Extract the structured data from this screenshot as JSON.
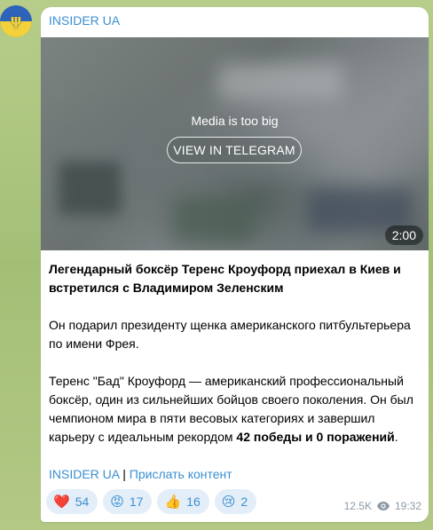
{
  "channel": {
    "name": "INSIDER UA",
    "avatar_icon": "ukraine-trident-avatar"
  },
  "media": {
    "message": "Media is too big",
    "button_label": "VIEW IN TELEGRAM",
    "duration": "2:00"
  },
  "post": {
    "title": "Легендарный боксёр Теренс Кроуфорд приехал в Киев и встретился с Владимиром Зеленским",
    "paragraph1": "Он подарил президенту щенка американского питбультерьера по имени Фрея.",
    "paragraph2_start": "Теренс \"Бад\" Кроуфорд — американский профессиональный боксёр, один из сильнейших бойцов своего поколения. Он был чемпионом мира в пяти весовых категориях и завершил карьеру с идеальным рекордом ",
    "paragraph2_bold": "42 победы и 0 поражений",
    "paragraph2_end": ".",
    "link1": "INSIDER UA",
    "separator": " | ",
    "link2": "Прислать контент"
  },
  "reactions": [
    {
      "emoji": "❤️",
      "icon": "heart-icon",
      "count": "54"
    },
    {
      "emoji": "😡",
      "icon": "angry-face-icon",
      "count": "17"
    },
    {
      "emoji": "👍",
      "icon": "thumbs-up-icon",
      "count": "16"
    },
    {
      "emoji": "😢",
      "icon": "crying-face-icon",
      "count": "2"
    }
  ],
  "meta": {
    "views": "12.5K",
    "time": "19:32"
  },
  "colors": {
    "accent": "#3a8fd1",
    "reaction_bg": "#e4eef8",
    "wallpaper": "#a9c27e"
  }
}
